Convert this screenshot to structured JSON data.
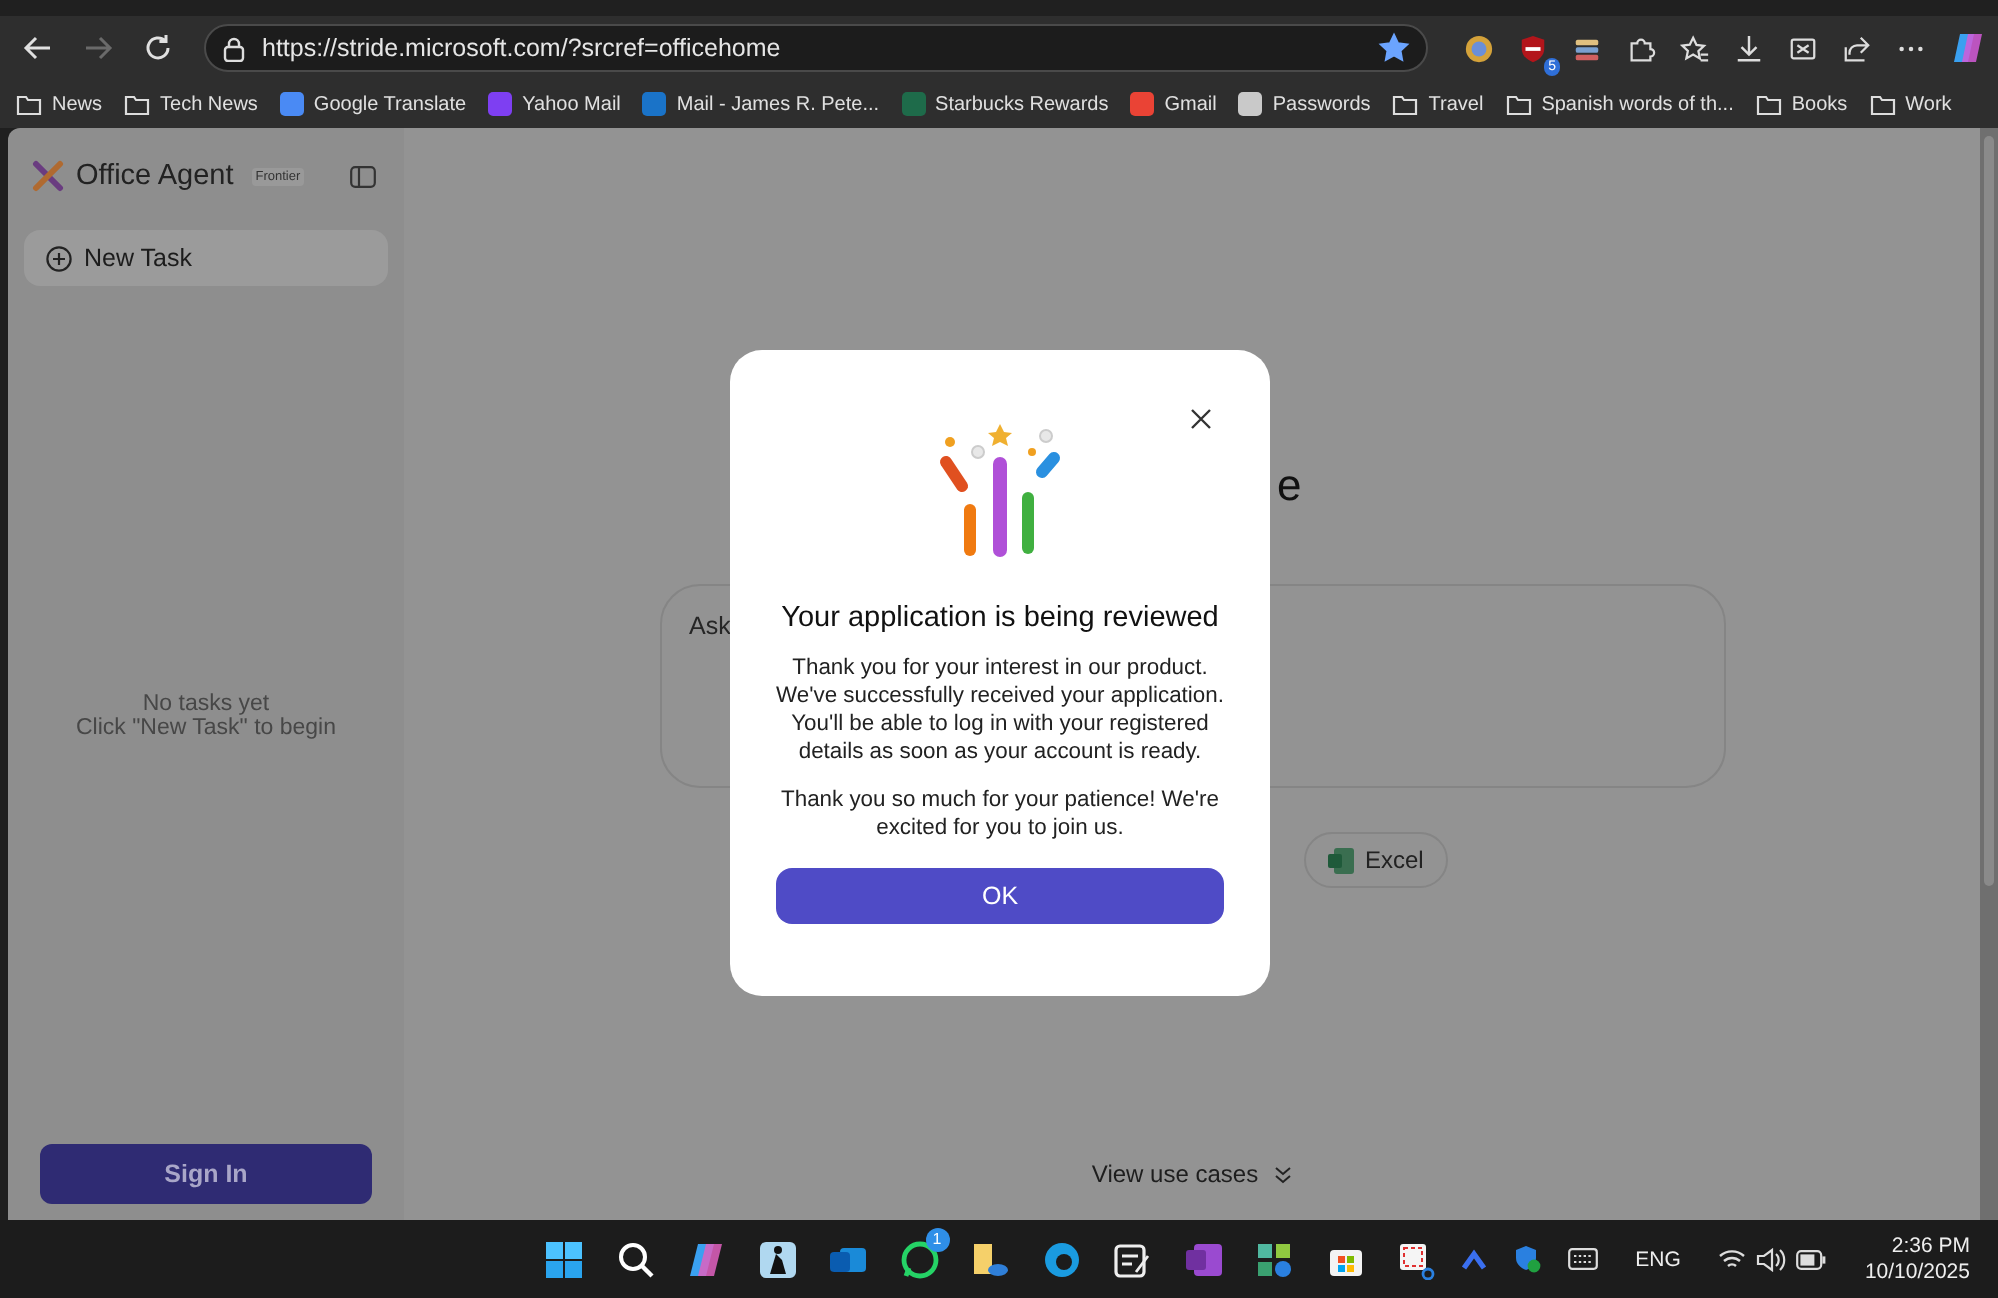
{
  "browser": {
    "nav": [
      {
        "kind": "back",
        "disabled": false
      },
      {
        "kind": "forward",
        "disabled": true
      },
      {
        "kind": "refresh",
        "disabled": false
      }
    ],
    "address": {
      "url": "https://stride.microsoft.com/?srcref=officehome",
      "favorite": true
    },
    "extension_badge": "5",
    "bookmarks": [
      {
        "label": "News",
        "kind": "folder"
      },
      {
        "label": "Tech News",
        "kind": "folder"
      },
      {
        "label": "Google Translate",
        "kind": "site",
        "color": "#4a8af4"
      },
      {
        "label": "Yahoo Mail",
        "kind": "site",
        "color": "#7e3ff2"
      },
      {
        "label": "Mail - James R. Pete...",
        "kind": "site",
        "color": "#1a73c8"
      },
      {
        "label": "Starbucks Rewards",
        "kind": "site",
        "color": "#1e6b4a"
      },
      {
        "label": "Gmail",
        "kind": "site",
        "color": "#ea4335"
      },
      {
        "label": "Passwords",
        "kind": "site",
        "color": "#c9c9c9"
      },
      {
        "label": "Travel",
        "kind": "folder"
      },
      {
        "label": "Spanish words of th...",
        "kind": "folder"
      },
      {
        "label": "Books",
        "kind": "folder"
      },
      {
        "label": "Work",
        "kind": "folder"
      }
    ]
  },
  "app": {
    "name": "Office Agent",
    "badge": "Frontier",
    "new_task": "New Task",
    "empty_title": "No tasks yet",
    "empty_hint": "Click \"New Task\" to begin",
    "sign_in": "Sign In"
  },
  "main": {
    "heading_fragment": "e",
    "prompt_fragment": "Ask",
    "chips": [
      {
        "label": "Excel"
      }
    ],
    "view_use_cases": "View use cases"
  },
  "dialog": {
    "title": "Your application is being reviewed",
    "paragraphs": [
      "Thank you for your interest in our product. We've successfully received your application. You'll be able to log in with your registered details as soon as your account is ready.",
      "Thank you so much for your patience! We're excited for you to join us."
    ],
    "ok": "OK"
  },
  "taskbar": {
    "chat_badge": "1",
    "language": "ENG",
    "time": "2:36 PM",
    "date": "10/10/2025"
  }
}
